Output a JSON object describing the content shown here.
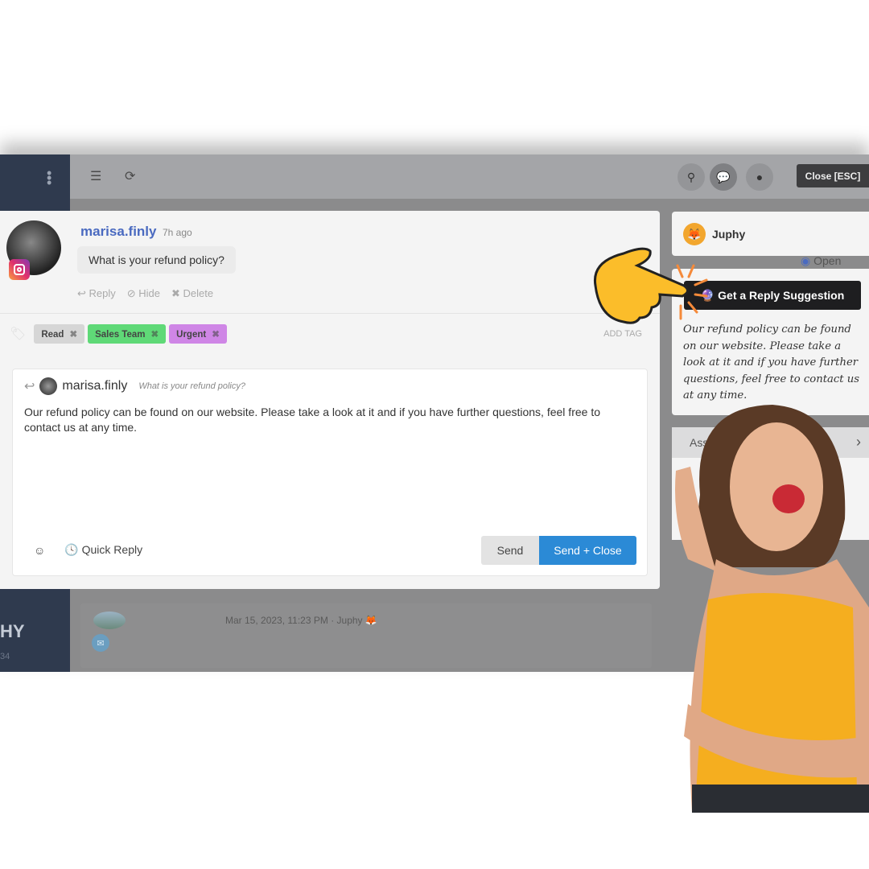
{
  "sidebar": {
    "brand": "HY",
    "brand_sub": "34"
  },
  "toolbar": {
    "close_label": "Close [ESC]",
    "icons": [
      "checklist-icon",
      "refresh-icon",
      "search-icon",
      "conversations-icon",
      "comment-icon"
    ]
  },
  "message": {
    "username": "marisa.finly",
    "time": "7h ago",
    "text": "What is your refund policy?",
    "actions": [
      "Reply",
      "Hide",
      "Delete"
    ],
    "channel": "instagram"
  },
  "tags": {
    "items": [
      {
        "label": "Read",
        "color": "#d6d6d6"
      },
      {
        "label": "Sales Team",
        "color": "#5fd977"
      },
      {
        "label": "Urgent",
        "color": "#cf86e6"
      }
    ],
    "add_label": "ADD TAG"
  },
  "composer": {
    "username": "marisa.finly",
    "quote": "What is your refund policy?",
    "body": "Our refund policy can be found on our website. Please take a look at it and if you have further questions, feel free to contact us at any time.",
    "quick_reply": "Quick Reply",
    "send": "Send",
    "send_close": "Send + Close"
  },
  "history": {
    "date": "Mar 15, 2023, 11:23 PM",
    "agent": "Juphy"
  },
  "right_panel": {
    "brand": "Juphy",
    "status": "Open",
    "suggest_button": "Get a Reply Suggestion",
    "suggestion": "Our refund policy can be found on our website. Please take a look at it and if you have further questions, feel free to contact us at any time.",
    "section": "Ass"
  },
  "colors": {
    "accent": "#2b8ad6",
    "username": "#4a6ac0",
    "sidebar": "#2f3a4e"
  }
}
